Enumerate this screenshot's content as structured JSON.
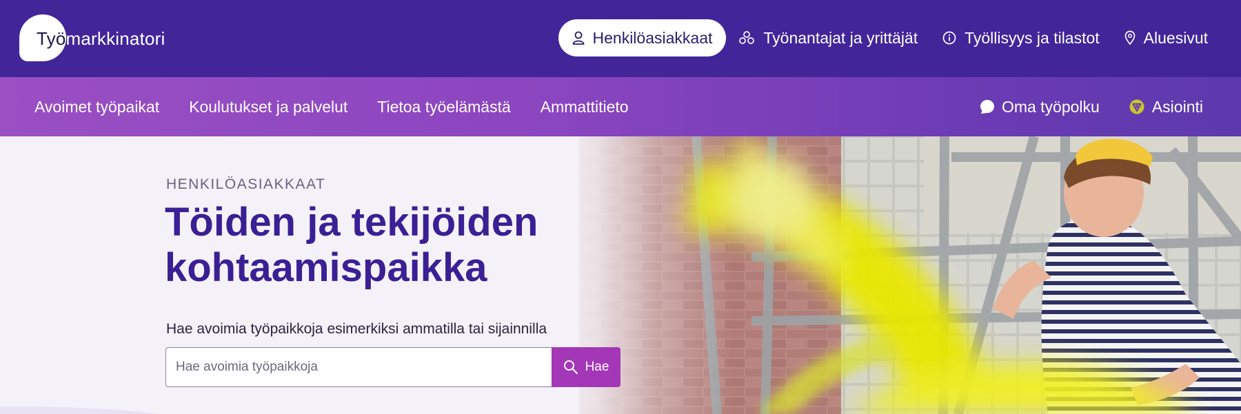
{
  "logo": {
    "part1": "Työ",
    "part2": "markkinatori"
  },
  "top_nav": {
    "items": [
      {
        "label": "Henkilöasiakkaat",
        "icon": "person-icon",
        "active": true
      },
      {
        "label": "Työnantajat ja yrittäjät",
        "icon": "people-group-icon",
        "active": false
      },
      {
        "label": "Työllisyys ja tilastot",
        "icon": "info-icon",
        "active": false
      },
      {
        "label": "Aluesivut",
        "icon": "location-pin-icon",
        "active": false
      }
    ]
  },
  "main_nav": {
    "items": [
      "Avoimet työpaikat",
      "Koulutukset ja palvelut",
      "Tietoa työelämästä",
      "Ammattitieto"
    ],
    "right_items": [
      {
        "label": "Oma työpolku",
        "icon": "speech-bubble-icon"
      },
      {
        "label": "Asiointi",
        "icon": "asiointi-icon"
      }
    ]
  },
  "hero": {
    "eyebrow": "HENKILÖASIAKKAAT",
    "title_line1": "Töiden ja tekijöiden",
    "title_line2": "kohtaamispaikka",
    "search_label": "Hae avoimia työpaikkoja esimerkiksi ammatilla tai sijainnilla",
    "search_placeholder": "Hae avoimia työpaikkoja",
    "search_button": "Hae"
  },
  "colors": {
    "header_bg": "#43259a",
    "subnav_bg": "#9a4fc3",
    "title": "#3b1f94",
    "search_button": "#a337b7",
    "asiointi_icon": "#c8c52a"
  }
}
